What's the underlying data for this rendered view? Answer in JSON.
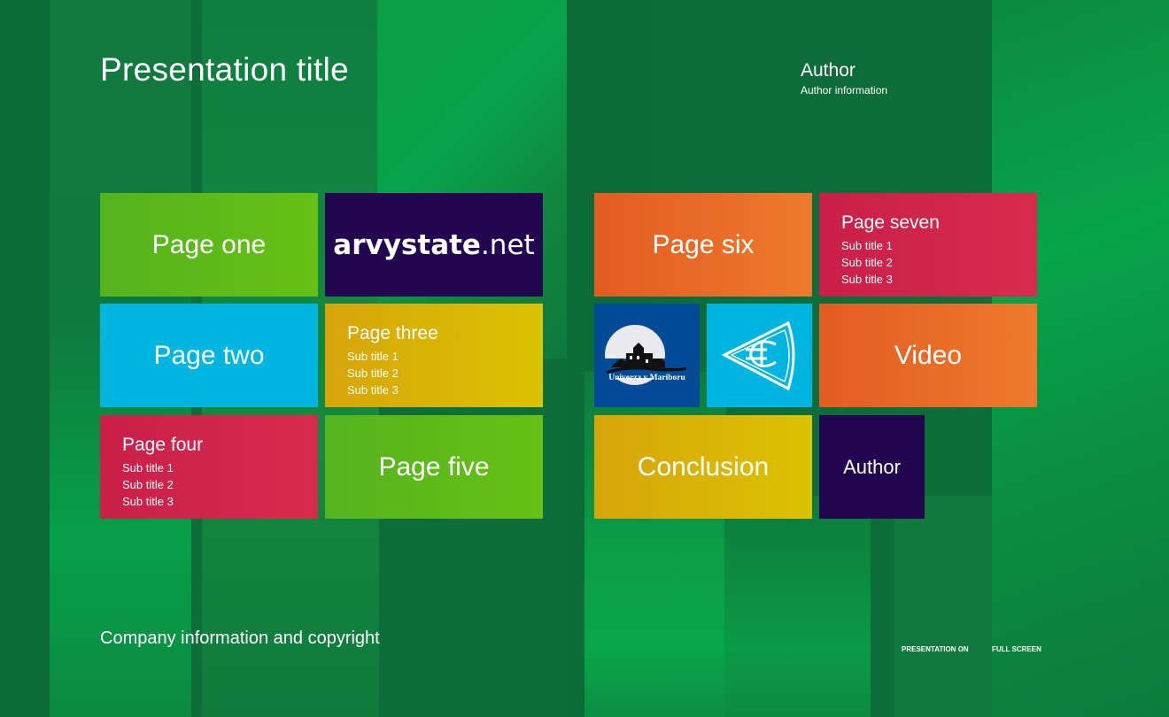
{
  "header": {
    "title": "Presentation title",
    "author": "Author",
    "author_info": "Author information"
  },
  "tiles": {
    "page_one": "Page one",
    "brand": {
      "bold": "arvystate",
      "rest": ".net"
    },
    "page_two": "Page two",
    "page_three": {
      "title": "Page three",
      "subs": [
        "Sub title 1",
        "Sub title 2",
        "Sub title 3"
      ]
    },
    "page_four": {
      "title": "Page four",
      "subs": [
        "Sub title 1",
        "Sub title 2",
        "Sub title 3"
      ]
    },
    "page_five": "Page five",
    "page_six": "Page six",
    "page_seven": {
      "title": "Page seven",
      "subs": [
        "Sub title 1",
        "Sub title 2",
        "Sub title 3"
      ]
    },
    "university": "Univerza v Mariboru",
    "video": "Video",
    "conclusion": "Conclusion",
    "author": "Author"
  },
  "footer": {
    "copyright": "Company information and copyright",
    "presentation_on": "PRESENTATION ON",
    "full_screen": "FULL SCREEN"
  },
  "colors": {
    "background": "#0e6e3a",
    "green": "#5db81a",
    "navy": "#22064f",
    "cyan": "#00b6e0",
    "yellow": "#d9b407",
    "crimson": "#d0264b",
    "orange": "#e86a28",
    "logo_blue": "#034b96"
  }
}
